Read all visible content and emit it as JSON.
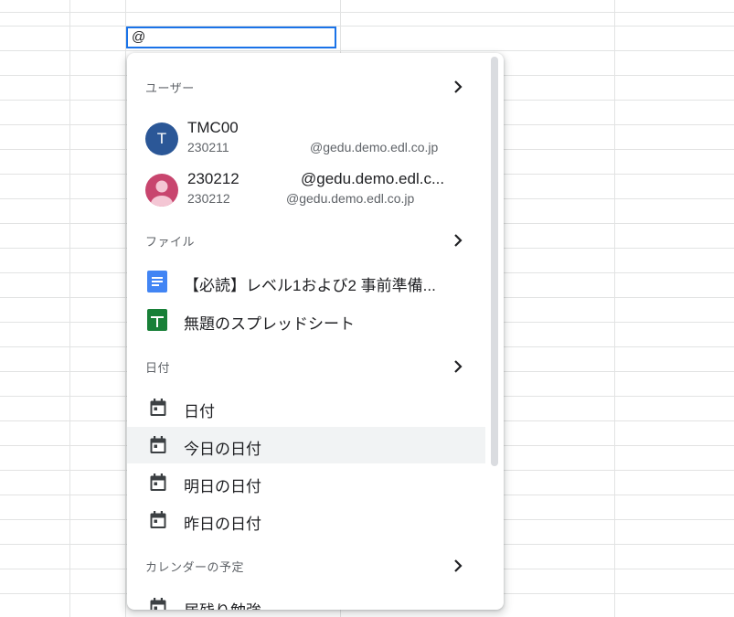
{
  "cell": {
    "input_value": "@"
  },
  "popup": {
    "users": {
      "header": "ユーザー",
      "items": [
        {
          "avatar_letter": "T",
          "name": "TMC00",
          "id": "230211",
          "email": "@gedu.demo.edl.co.jp"
        },
        {
          "name": "230212",
          "name_email": "@gedu.demo.edl.c...",
          "id": "230212",
          "email": "@gedu.demo.edl.co.jp"
        }
      ]
    },
    "files": {
      "header": "ファイル",
      "items": [
        {
          "icon": "google-docs-icon",
          "label": "【必読】レベル1および2 事前準備..."
        },
        {
          "icon": "google-sheets-icon",
          "label": "無題のスプレッドシート"
        }
      ]
    },
    "dates": {
      "header": "日付",
      "items": [
        {
          "icon": "calendar-icon",
          "label": "日付"
        },
        {
          "icon": "calendar-icon",
          "label": "今日の日付"
        },
        {
          "icon": "calendar-icon",
          "label": "明日の日付"
        },
        {
          "icon": "calendar-icon",
          "label": "昨日の日付"
        }
      ]
    },
    "calendar": {
      "header": "カレンダーの予定",
      "items": [
        {
          "icon": "calendar-icon",
          "label": "居残り勉強"
        }
      ]
    }
  },
  "colors": {
    "accent": "#1a73e8",
    "avatar_blue": "#2b5797",
    "avatar_pink": "#c8456e",
    "docs_blue": "#4285f4",
    "sheets_green": "#188038",
    "highlight": "#f1f3f4"
  }
}
